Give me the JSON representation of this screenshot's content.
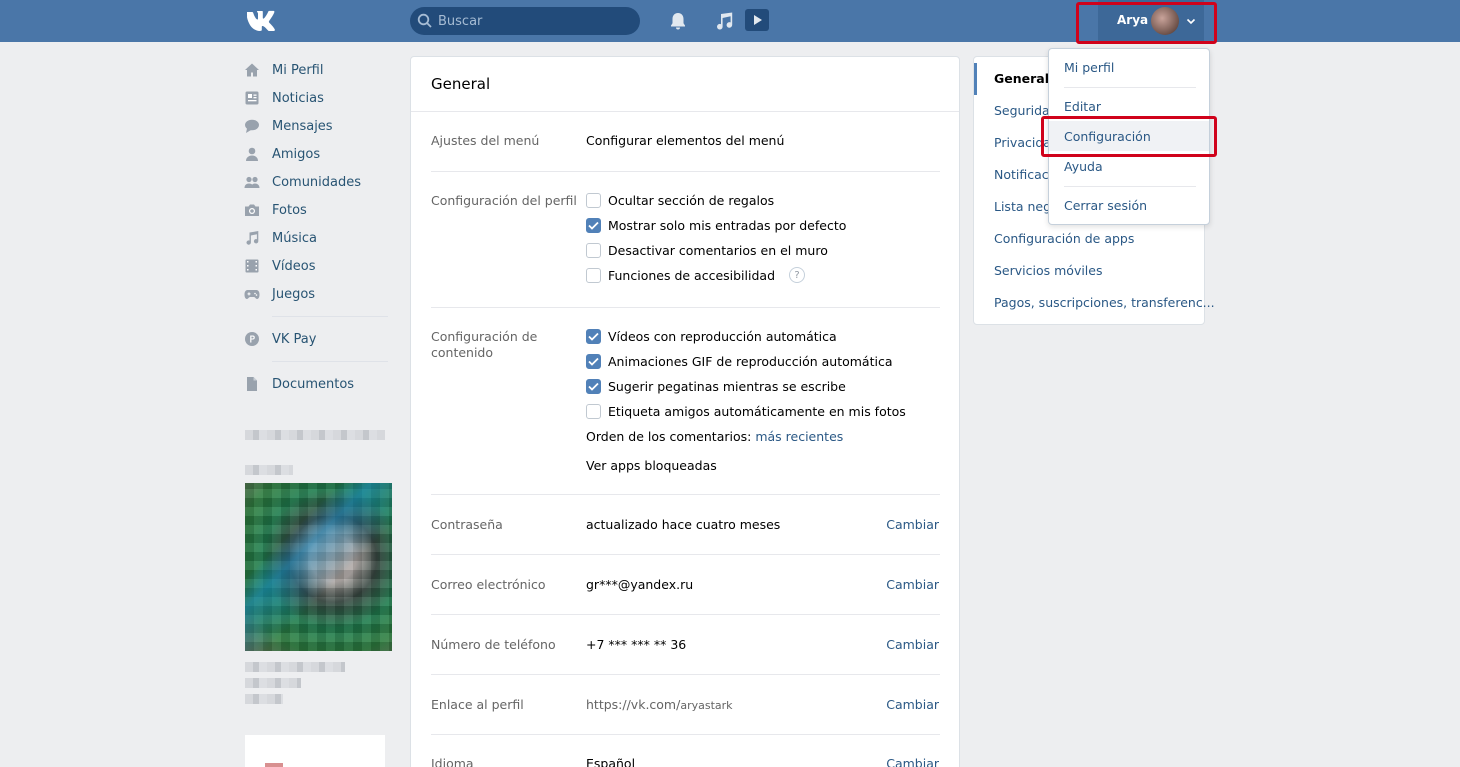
{
  "header": {
    "search_placeholder": "Buscar",
    "user_name": "Arya"
  },
  "nav": {
    "items": [
      {
        "label": "Mi Perfil",
        "icon": "home-icon"
      },
      {
        "label": "Noticias",
        "icon": "news-icon"
      },
      {
        "label": "Mensajes",
        "icon": "messages-icon"
      },
      {
        "label": "Amigos",
        "icon": "friend-icon"
      },
      {
        "label": "Comunidades",
        "icon": "communities-icon"
      },
      {
        "label": "Fotos",
        "icon": "camera-icon"
      },
      {
        "label": "Música",
        "icon": "music-icon"
      },
      {
        "label": "Vídeos",
        "icon": "video-icon"
      },
      {
        "label": "Juegos",
        "icon": "gamepad-icon"
      }
    ],
    "vkpay": "VK Pay",
    "documentos": "Documentos"
  },
  "main": {
    "title": "General",
    "menu_settings": {
      "label": "Ajustes del menú",
      "link": "Configurar elementos del menú"
    },
    "profile_settings": {
      "label": "Configuración del perfil",
      "options": [
        {
          "text": "Ocultar sección de regalos",
          "checked": false
        },
        {
          "text": "Mostrar solo mis entradas por defecto",
          "checked": true
        },
        {
          "text": "Desactivar comentarios en el muro",
          "checked": false
        },
        {
          "text": "Funciones de accesibilidad",
          "checked": false
        }
      ],
      "help": "?"
    },
    "content_settings": {
      "label_line1": "Configuración de",
      "label_line2": "contenido",
      "options": [
        {
          "text": "Vídeos con reproducción automática",
          "checked": true
        },
        {
          "text": "Animaciones GIF de reproducción automática",
          "checked": true
        },
        {
          "text": "Sugerir pegatinas mientras se escribe",
          "checked": true
        },
        {
          "text": "Etiqueta amigos automáticamente en mis fotos",
          "checked": false
        }
      ],
      "comment_order_label": "Orden de los comentarios:",
      "comment_order_value": "más recientes",
      "blocked_apps": "Ver apps bloqueadas"
    },
    "rows": [
      {
        "label": "Contraseña",
        "value": "actualizado hace cuatro meses",
        "action": "Cambiar"
      },
      {
        "label": "Correo electrónico",
        "value": "gr***@yandex.ru",
        "action": "Cambiar"
      },
      {
        "label": "Número de teléfono",
        "value": "+7 *** *** ** 36",
        "action": "Cambiar"
      },
      {
        "label": "Enlace al perfil",
        "value_prefix": "https://vk.com/",
        "value_suffix": "aryastark",
        "action": "Cambiar"
      },
      {
        "label": "Idioma",
        "value": "Español",
        "action": "Cambiar"
      }
    ]
  },
  "right_menu": {
    "items": [
      "General",
      "Seguridad",
      "Privacidad",
      "Notificaciones",
      "Lista negra",
      "Configuración de apps",
      "Servicios móviles",
      "Pagos, suscripciones, transferenc..."
    ]
  },
  "dropdown": {
    "items": [
      "Mi perfil",
      "Editar",
      "Configuración",
      "Ayuda",
      "Cerrar sesión"
    ]
  },
  "colors": {
    "header": "#4a76a8",
    "link": "#2a5885",
    "highlight": "#d0021b",
    "checkbox": "#5181b8"
  }
}
